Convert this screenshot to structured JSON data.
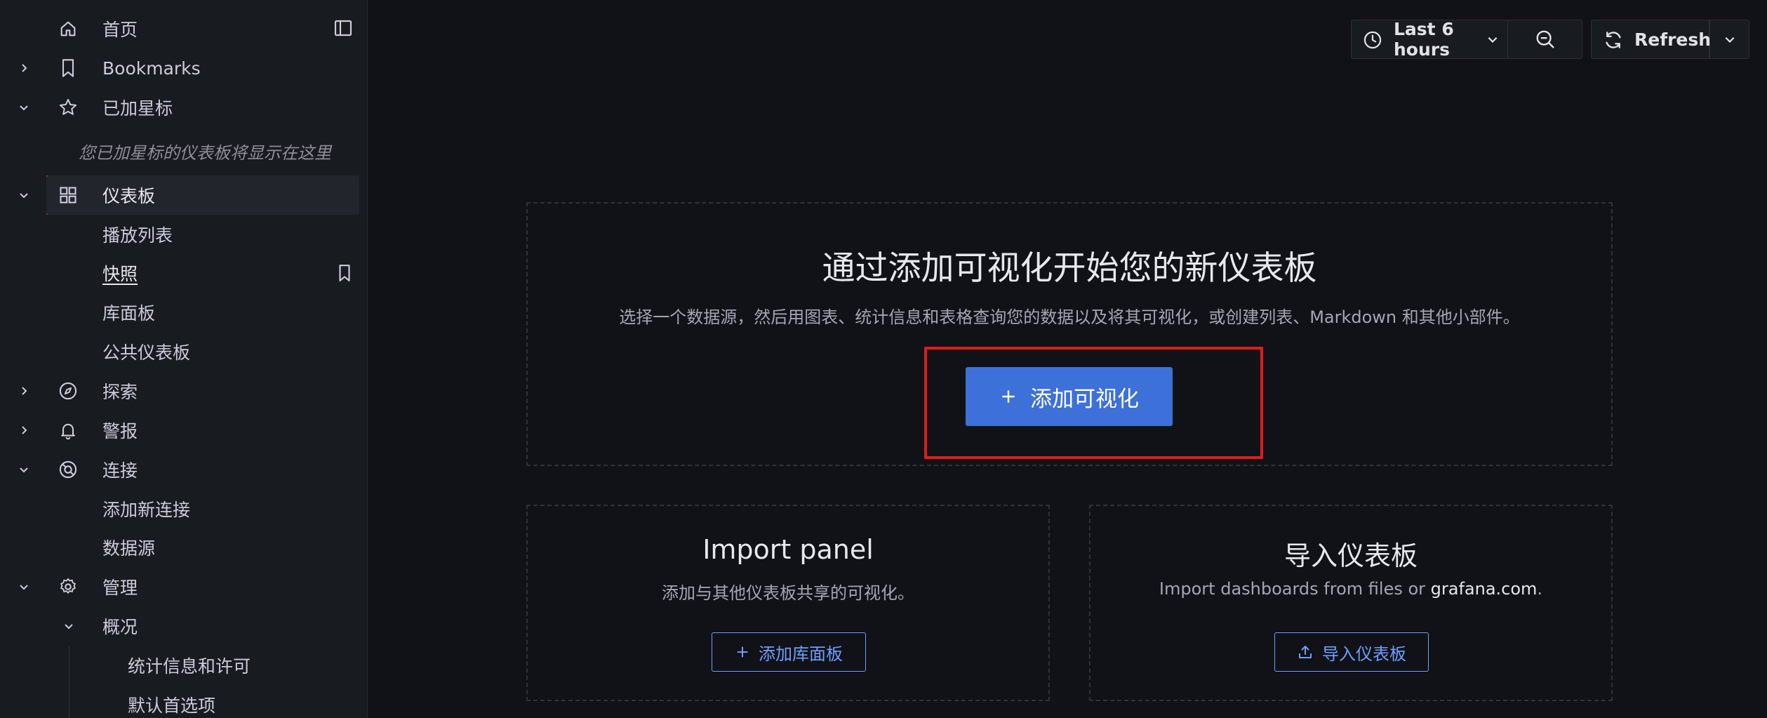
{
  "sidebar": {
    "home": "首页",
    "bookmarks": "Bookmarks",
    "starred": "已加星标",
    "starred_hint": "您已加星标的仪表板将显示在这里",
    "dashboards": "仪表板",
    "playlists": "播放列表",
    "snapshots": "快照",
    "library_panels": "库面板",
    "public_dashboards": "公共仪表板",
    "explore": "探索",
    "alerting": "警报",
    "connections": "连接",
    "add_connection": "添加新连接",
    "data_sources": "数据源",
    "administration": "管理",
    "overview": "概况",
    "stats_license": "统计信息和许可",
    "default_prefs": "默认首选项"
  },
  "toolbar": {
    "time_range": "Last 6 hours",
    "refresh": "Refresh"
  },
  "main": {
    "title": "通过添加可视化开始您的新仪表板",
    "description": "选择一个数据源，然后用图表、统计信息和表格查询您的数据以及将其可视化，或创建列表、Markdown 和其他小部件。",
    "add_viz_button": "添加可视化"
  },
  "import_panel": {
    "title": "Import panel",
    "description": "添加与其他仪表板共享的可视化。",
    "button": "添加库面板"
  },
  "import_dashboard": {
    "title": "导入仪表板",
    "description_prefix": "Import dashboards from files or ",
    "description_link": "grafana.com",
    "description_suffix": ".",
    "button": "导入仪表板"
  },
  "colors": {
    "accent": "#3d71d9",
    "highlight": "#e21b1b",
    "active_bar": "#f55f3e"
  }
}
